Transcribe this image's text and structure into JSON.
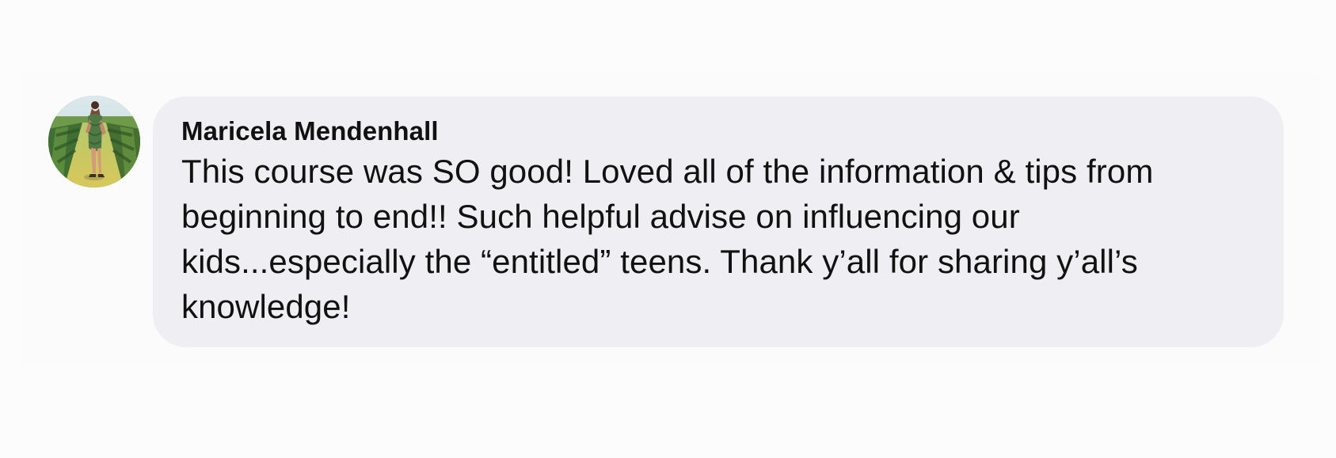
{
  "comment": {
    "author": "Maricela Mendenhall",
    "text": "This course was SO good! Loved all of the information & tips from beginning to end!! Such helpful advise on influencing our kids...especially the “entitled” teens. Thank y’all for sharing y’all’s knowledge!",
    "avatar_icon": "profile-photo-avatar"
  },
  "colors": {
    "page_background": "#fcfcfd",
    "bubble_background": "#efeff3",
    "text": "#111111"
  }
}
